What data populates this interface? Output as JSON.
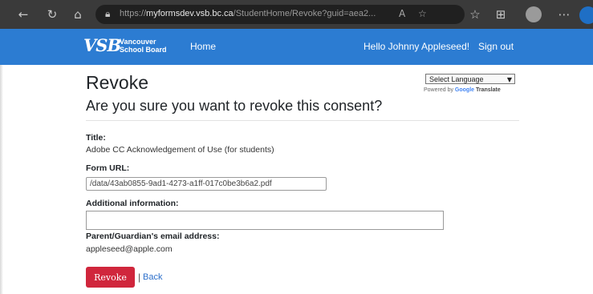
{
  "browser": {
    "url_prefix": "https://",
    "url_host": "myformsdev.vsb.bc.ca",
    "url_path": "/StudentHome/Revoke?guid=aea2..."
  },
  "navbar": {
    "logo_mark": "VSB",
    "logo_line1": "Vancouver",
    "logo_line2": "School Board",
    "home_label": "Home",
    "greeting": "Hello Johnny Appleseed!",
    "signout_label": "Sign out"
  },
  "language": {
    "select_label": "Select Language",
    "powered_by": "Powered by",
    "google": "Google",
    "translate": "Translate"
  },
  "page": {
    "title": "Revoke",
    "question": "Are you sure you want to revoke this consent?"
  },
  "form": {
    "title_label": "Title:",
    "title_value": "Adobe CC Acknowledgement of Use (for students)",
    "url_label": "Form URL:",
    "url_value": "/data/43ab0855-9ad1-4273-a1ff-017c0be3b6a2.pdf",
    "info_label": "Additional information:",
    "info_value": "",
    "email_label": "Parent/Guardian's email address:",
    "email_value": "appleseed@apple.com",
    "revoke_label": "Revoke",
    "separator": "|",
    "back_label": "Back"
  },
  "colors": {
    "navbar": "#2c7cd2",
    "revoke_button": "#d0263c",
    "link": "#2c6fca"
  }
}
